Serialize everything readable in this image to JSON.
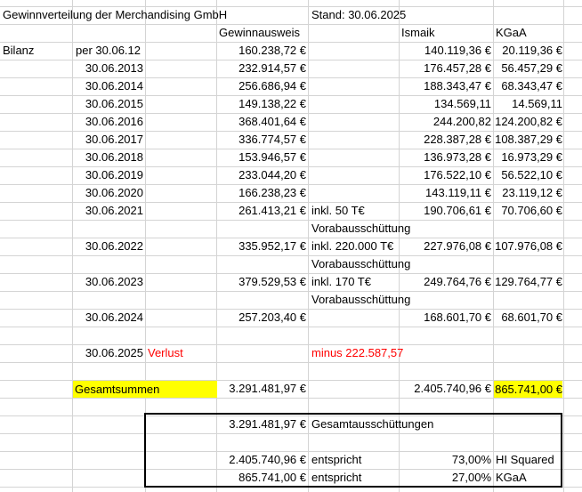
{
  "title": "Gewinnverteilung der Merchandising GmbH",
  "stand": "Stand: 30.06.2025",
  "headers": {
    "gewinn": "Gewinnausweis",
    "ismaik": "Ismaik",
    "kgaa": "KGaA"
  },
  "bilanz_label": "Bilanz",
  "rows": [
    {
      "date": "per 30.06.12",
      "gewinn": "160.238,72 €",
      "note": "",
      "ismaik": "140.119,36 €",
      "kgaa": "20.119,36 €"
    },
    {
      "date": "30.06.2013",
      "gewinn": "232.914,57 €",
      "note": "",
      "ismaik": "176.457,28 €",
      "kgaa": "56.457,29 €"
    },
    {
      "date": "30.06.2014",
      "gewinn": "256.686,94 €",
      "note": "",
      "ismaik": "188.343,47 €",
      "kgaa": "68.343,47 €"
    },
    {
      "date": "30.06.2015",
      "gewinn": "149.138,22 €",
      "note": "",
      "ismaik": "134.569,11",
      "kgaa": "14.569,11"
    },
    {
      "date": "30.06.2016",
      "gewinn": "368.401,64 €",
      "note": "",
      "ismaik": "244.200,82",
      "kgaa": "124.200,82 €"
    },
    {
      "date": "30.06.2017",
      "gewinn": "336.774,57 €",
      "note": "",
      "ismaik": "228.387,28 €",
      "kgaa": "108.387,29 €"
    },
    {
      "date": "30.06.2018",
      "gewinn": "153.946,57 €",
      "note": "",
      "ismaik": "136.973,28 €",
      "kgaa": "16.973,29 €"
    },
    {
      "date": "30.06.2019",
      "gewinn": "233.044,20 €",
      "note": "",
      "ismaik": "176.522,10 €",
      "kgaa": "56.522,10 €"
    },
    {
      "date": "30.06.2020",
      "gewinn": "166.238,23 €",
      "note": "",
      "ismaik": "143.119,11 €",
      "kgaa": "23.119,12 €"
    },
    {
      "date": "30.06.2021",
      "gewinn": "261.413,21 €",
      "note": "inkl. 50 T€",
      "ismaik": "190.706,61 €",
      "kgaa": "70.706,60 €"
    },
    {
      "date": "",
      "gewinn": "",
      "note": "Vorabausschüttung",
      "ismaik": "",
      "kgaa": ""
    },
    {
      "date": "30.06.2022",
      "gewinn": "335.952,17 €",
      "note": "inkl. 220.000 T€",
      "ismaik": "227.976,08 €",
      "kgaa": "107.976,08 €"
    },
    {
      "date": "",
      "gewinn": "",
      "note": "Vorabausschüttung",
      "ismaik": "",
      "kgaa": ""
    },
    {
      "date": "30.06.2023",
      "gewinn": "379.529,53 €",
      "note": "inkl. 170 T€",
      "ismaik": "249.764,76 €",
      "kgaa": "129.764,77 €"
    },
    {
      "date": "",
      "gewinn": "",
      "note": "Vorabausschüttung",
      "ismaik": "",
      "kgaa": ""
    },
    {
      "date": "30.06.2024",
      "gewinn": "257.203,40 €",
      "note": "",
      "ismaik": "168.601,70 €",
      "kgaa": "68.601,70 €"
    }
  ],
  "row2025": {
    "date": "30.06.2025",
    "verlust": "Verlust",
    "minus": "minus 222.587,57"
  },
  "gesamt": {
    "label": "Gesamtsummen",
    "gewinn": "3.291.481,97 €",
    "ismaik": "2.405.740,96 €",
    "kgaa": "865.741,00 €"
  },
  "summary": {
    "total": "3.291.481,97 €",
    "total_label": "Gesamtausschüttungen",
    "row1": {
      "amount": "2.405.740,96 €",
      "label": "entspricht",
      "pct": "73,00%",
      "name": "HI Squared"
    },
    "row2": {
      "amount": "865.741,00 €",
      "label": "entspricht",
      "pct": "27,00%",
      "name": "KGaA"
    }
  }
}
